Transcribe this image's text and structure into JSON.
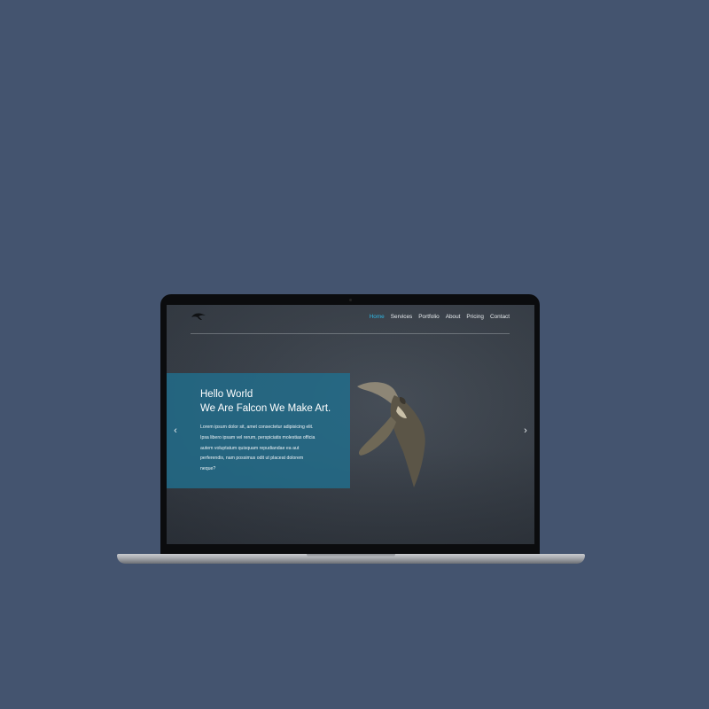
{
  "nav": {
    "items": [
      {
        "label": "Home",
        "active": true
      },
      {
        "label": "Services",
        "active": false
      },
      {
        "label": "Portfolio",
        "active": false
      },
      {
        "label": "About",
        "active": false
      },
      {
        "label": "Pricing",
        "active": false
      },
      {
        "label": "Contact",
        "active": false
      }
    ]
  },
  "hero": {
    "hello": "Hello World",
    "tagline": "We Are Falcon We Make Art.",
    "lines": [
      "Lorem ipsum dolor sit, amet consectetur adipisicing elit.",
      "Ipsa libero ipsam vel rerum, perspiciatis molestias officia",
      "autem voluptatum quisquam repudiandae ea aut",
      "perferendis, nam possimus odit ut placeat dolorem",
      "neque?"
    ]
  },
  "slider": {
    "prev_icon": "chevron-left-icon",
    "next_icon": "chevron-right-icon",
    "prev_glyph": "‹",
    "next_glyph": "›"
  },
  "colors": {
    "page_background": "#44546f",
    "nav_active": "#2fb6e3",
    "hero_box": "#216e8c"
  }
}
